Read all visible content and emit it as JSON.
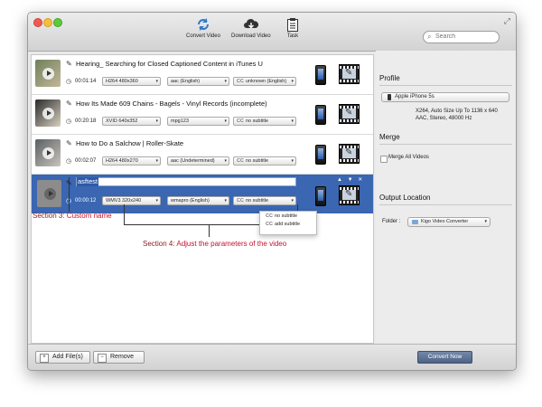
{
  "toolbar": {
    "convert_video": "Convert Video",
    "download_video": "Download Video",
    "task": "Task",
    "search_placeholder": "Search"
  },
  "videos": [
    {
      "title": "Hearing_ Searching for Closed Captioned Content in iTunes U",
      "duration": "00:01:14",
      "video": "H264 480x360",
      "audio": "aac (English)",
      "subtitle": "unknown (English)"
    },
    {
      "title": "How Its Made 609 Chains - Bagels - Vinyl Records (incomplete)",
      "duration": "00:20:18",
      "video": "XVID 640x352",
      "audio": "mpg123",
      "subtitle": "no subtitle"
    },
    {
      "title": "How to Do a Salchow | Roller-Skate",
      "duration": "00:02:07",
      "video": "H264 480x270",
      "audio": "aac (Undetermined)",
      "subtitle": "no subtitle"
    },
    {
      "title": "asftest",
      "duration": "00:00:12",
      "video": "WMV3 320x240",
      "audio": "wmapro (English)",
      "subtitle": "no subtitle"
    }
  ],
  "cc": "CC",
  "row_controls": [
    "▲",
    "▼",
    "✕"
  ],
  "subtitle_popup": [
    "no subtitle",
    "add subtitle"
  ],
  "profile": {
    "heading": "Profile",
    "device": "Apple iPhone 5s",
    "line1": "X264, Auto Size Up To 1136 x 640",
    "line2": "AAC, Stereo, 48000 Hz"
  },
  "merge": {
    "heading": "Merge",
    "label": "Merge All Videos"
  },
  "output": {
    "heading": "Output Location",
    "folder_label": "Folder :",
    "folder": "Kigo Video Converter"
  },
  "footer": {
    "add_files": "Add File(s)",
    "remove": "Remove",
    "convert_now": "Convert Now"
  },
  "annotations": {
    "section3_key": "Section 3:",
    "section3_text": " Custom name",
    "section4_key": "Section 4:",
    "section4_text": " Adjust the parameters of the video"
  },
  "colors": {
    "selection": "#3a66b2",
    "annotation": "#c8102e"
  }
}
